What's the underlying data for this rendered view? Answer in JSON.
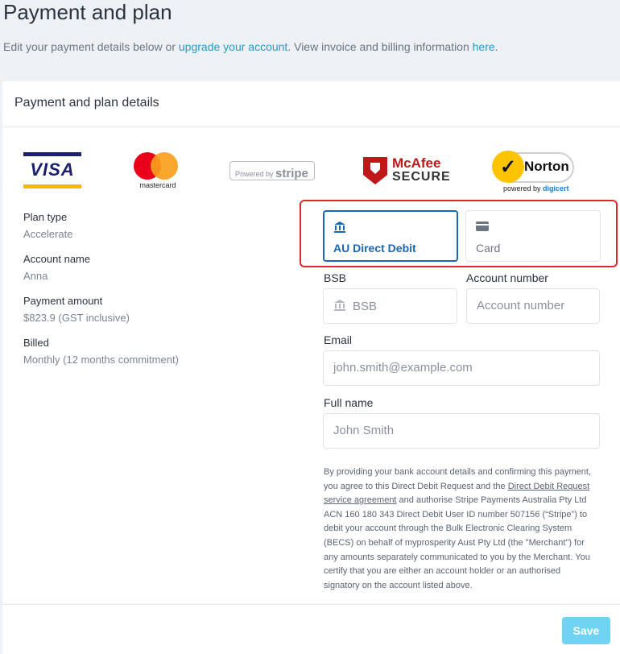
{
  "page": {
    "title": "Payment and plan",
    "subtitle_prefix": "Edit your payment details below or ",
    "upgrade_link": "upgrade your account",
    "subtitle_middle": ". View invoice and billing information ",
    "here_link": "here",
    "subtitle_suffix": "."
  },
  "card": {
    "header": "Payment and plan details"
  },
  "logos": {
    "visa": "VISA",
    "mastercard": "mastercard",
    "stripe_prefix": "Powered by",
    "stripe_brand": "stripe",
    "mcafee_line1": "McAfee",
    "mcafee_line2": "SECURE",
    "norton": "Norton",
    "norton_powered": "powered by ",
    "norton_digicert": "digicert"
  },
  "plan": {
    "plan_type_label": "Plan type",
    "plan_type_value": "Accelerate",
    "account_name_label": "Account name",
    "account_name_value": "Anna",
    "payment_amount_label": "Payment amount",
    "payment_amount_value": "$823.9 (GST inclusive)",
    "billed_label": "Billed",
    "billed_value": "Monthly (12 months commitment)"
  },
  "methods": [
    {
      "label": "AU Direct Debit",
      "icon": "bank-icon",
      "selected": true
    },
    {
      "label": "Card",
      "icon": "credit-card-icon",
      "selected": false
    }
  ],
  "form": {
    "bsb_label": "BSB",
    "bsb_placeholder": "BSB",
    "account_number_label": "Account number",
    "account_number_placeholder": "Account number",
    "email_label": "Email",
    "email_placeholder": "john.smith@example.com",
    "full_name_label": "Full name",
    "full_name_placeholder": "John Smith"
  },
  "legal": {
    "part1": "By providing your bank account details and confirming this payment, you agree to this Direct Debit Request and the ",
    "link": "Direct Debit Request service agreement",
    "part2": " and authorise Stripe Payments Australia Pty Ltd ACN 160 180 343 Direct Debit User ID number 507156 (“Stripe”) to debit your account through the Bulk Electronic Clearing System (BECS) on behalf of myprosperity Aust Pty Ltd (the \"Merchant\") for any amounts separately communicated to you by the Merchant. You certify that you are either an account holder or an authorised signatory on the account listed above."
  },
  "actions": {
    "save": "Save"
  },
  "colors": {
    "accent": "#1a66b8",
    "link": "#2a9bc7",
    "highlight": "#e3262b",
    "save_button": "#6fd3f1"
  }
}
